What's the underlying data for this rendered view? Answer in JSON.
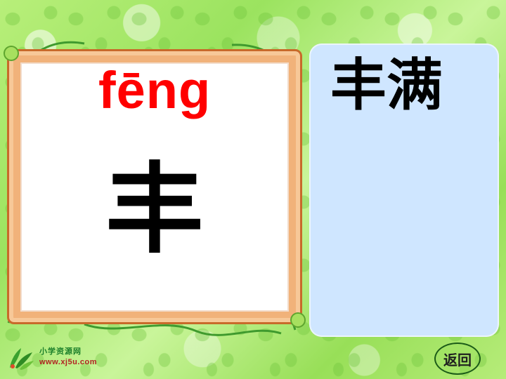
{
  "card": {
    "pinyin": "fēng",
    "hanzi": "丰"
  },
  "side_panel": {
    "word": "丰满"
  },
  "logo": {
    "name": "小学资源网",
    "url": "www.xj5u.com"
  },
  "buttons": {
    "back_label": "返回"
  },
  "colors": {
    "pinyin": "#ff0000",
    "panel": "#cfe6ff",
    "frame": "#f1b27a",
    "background": "#b8ef7a"
  },
  "icons": {
    "logo_mark": "leaf-logo-icon"
  }
}
